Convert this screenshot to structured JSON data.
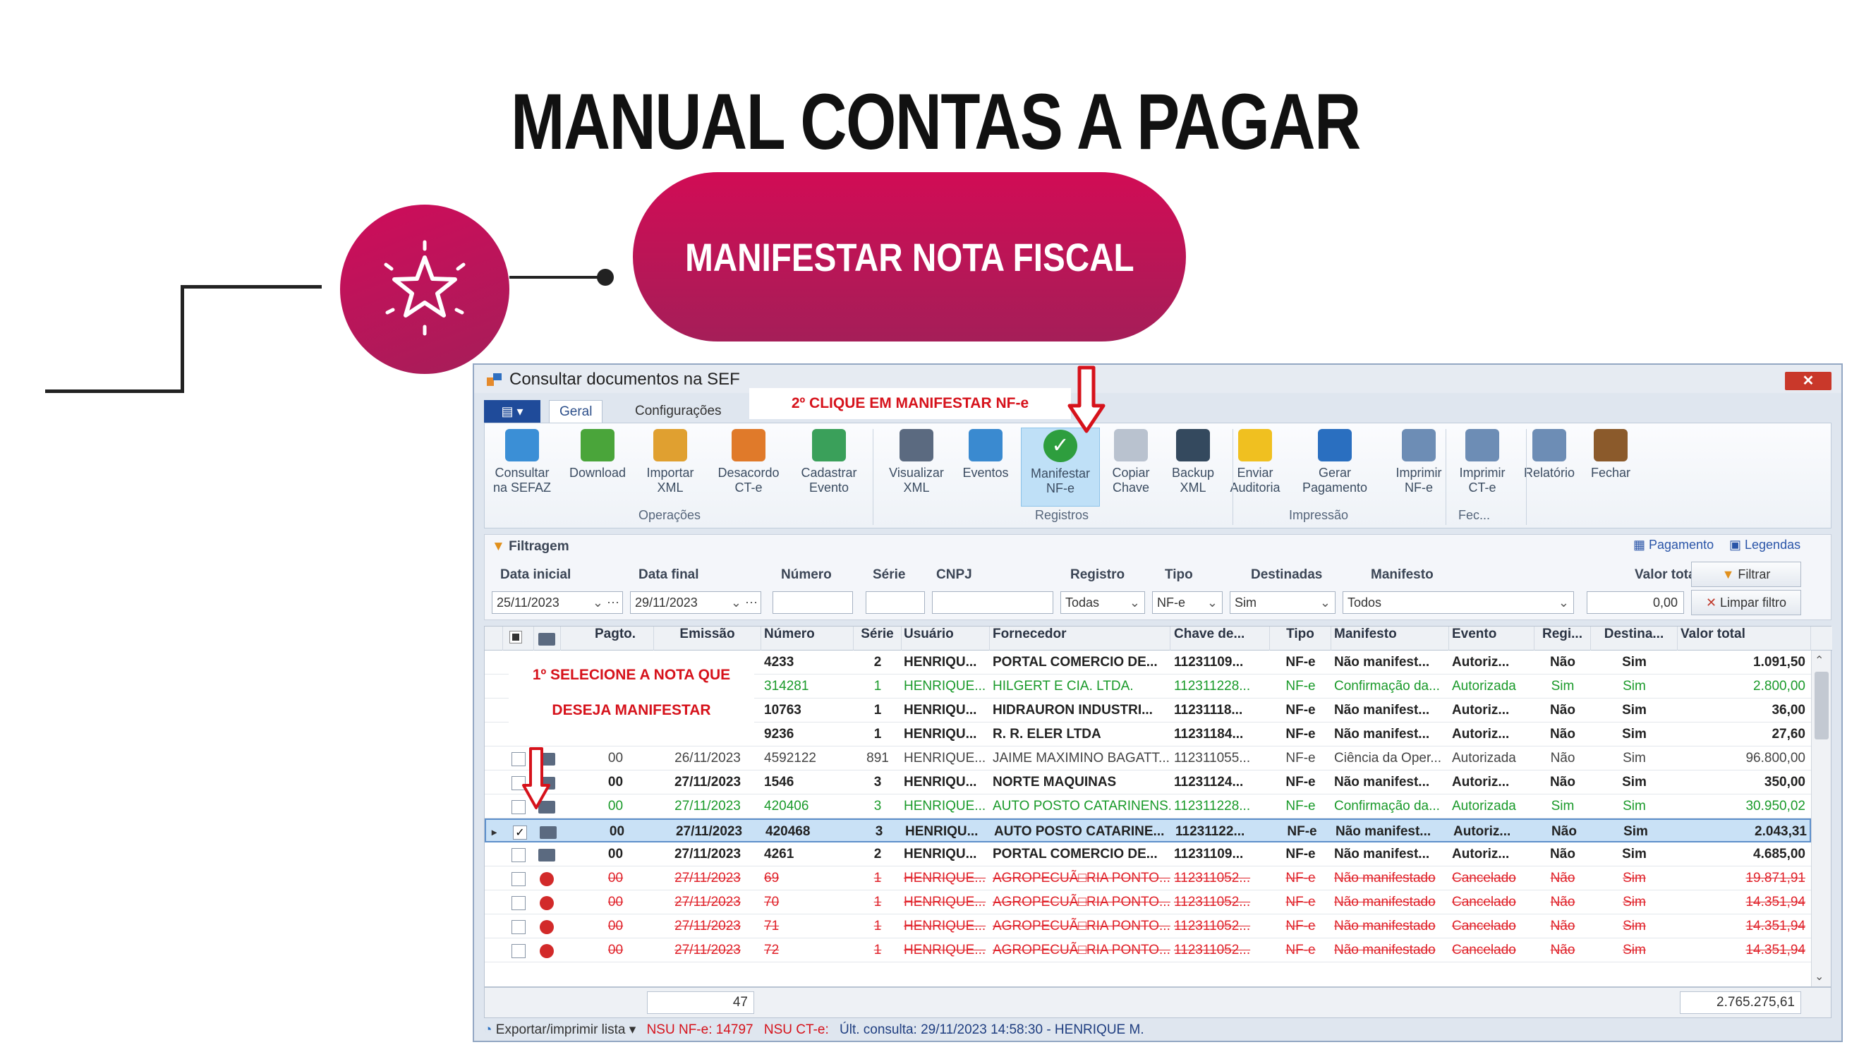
{
  "heading": "MANUAL CONTAS A PAGAR",
  "pill_label": "MANIFESTAR NOTA FISCAL",
  "window": {
    "title": "Consultar documentos na SEF",
    "tabs": [
      "Geral",
      "Configurações"
    ],
    "callout_step2": "2º CLIQUE EM MANIFESTAR NF-e",
    "ribbon_buttons": [
      {
        "label1": "Consultar",
        "label2": "na SEFAZ",
        "icon": "refresh-icon"
      },
      {
        "label1": "Download",
        "label2": "",
        "icon": "download-icon"
      },
      {
        "label1": "Importar",
        "label2": "XML",
        "icon": "import-xml-icon"
      },
      {
        "label1": "Desacordo",
        "label2": "CT-e",
        "icon": "thumbs-down-icon"
      },
      {
        "label1": "Cadastrar",
        "label2": "Evento",
        "icon": "flag-icon"
      },
      {
        "label1": "Visualizar",
        "label2": "XML",
        "icon": "view-xml-icon"
      },
      {
        "label1": "Eventos",
        "label2": "",
        "icon": "magnifier-icon"
      },
      {
        "label1": "Manifestar",
        "label2": "NF-e",
        "icon": "check-circle-icon"
      },
      {
        "label1": "Copiar",
        "label2": "Chave",
        "icon": "copy-icon"
      },
      {
        "label1": "Backup",
        "label2": "XML",
        "icon": "floppy-icon"
      },
      {
        "label1": "Enviar",
        "label2": "Auditoria",
        "icon": "audit-icon"
      },
      {
        "label1": "Gerar",
        "label2": "Pagamento",
        "icon": "payment-icon"
      },
      {
        "label1": "Imprimir",
        "label2": "NF-e",
        "icon": "printer-icon"
      },
      {
        "label1": "Imprimir",
        "label2": "CT-e",
        "icon": "printer-icon"
      },
      {
        "label1": "Relatório",
        "label2": "",
        "icon": "printer-icon"
      },
      {
        "label1": "Fechar",
        "label2": "",
        "icon": "exit-door-icon"
      }
    ],
    "ribbon_groups": [
      "Operações",
      "Registros",
      "Impressão",
      "Fec..."
    ],
    "filter": {
      "title": "Filtragem",
      "pagamento": "Pagamento",
      "legendas": "Legendas",
      "labels": [
        "Data inicial",
        "Data final",
        "Número",
        "Série",
        "CNPJ",
        "Registro",
        "Tipo",
        "Destinadas",
        "Manifesto",
        "Valor total"
      ],
      "data_inicial": "25/11/2023",
      "data_final": "29/11/2023",
      "registro": "Todas",
      "tipo": "NF-e",
      "destinadas": "Sim",
      "manifesto": "Todos",
      "valor_total": "0,00",
      "filtrar": "Filtrar",
      "limpar": "Limpar filtro"
    },
    "grid": {
      "headers": [
        "Pagto.",
        "Emissão",
        "Número",
        "Série",
        "Usuário",
        "Fornecedor",
        "Chave de...",
        "Tipo",
        "Manifesto",
        "Evento",
        "Regi...",
        "Destina...",
        "Valor total"
      ],
      "callout_step1_line1": "1º SELECIONE A NOTA QUE",
      "callout_step1_line2": "DESEJA MANIFESTAR",
      "rows": [
        {
          "style": "bold",
          "check": false,
          "icon": "none",
          "pagto": "",
          "emissao": "",
          "numero": "4233",
          "serie": "2",
          "usuario": "HENRIQU...",
          "fornecedor": "PORTAL COMERCIO DE...",
          "chave": "11231109...",
          "tipo": "NF-e",
          "manifesto": "Não manifest...",
          "evento": "Autoriz...",
          "registro": "Não",
          "destinada": "Sim",
          "valor": "1.091,50"
        },
        {
          "style": "green",
          "check": false,
          "icon": "none",
          "pagto": "",
          "emissao": "",
          "numero": "314281",
          "serie": "1",
          "usuario": "HENRIQUE...",
          "fornecedor": "HILGERT E CIA. LTDA.",
          "chave": "112311228...",
          "tipo": "NF-e",
          "manifesto": "Confirmação da...",
          "evento": "Autorizada",
          "registro": "Sim",
          "destinada": "Sim",
          "valor": "2.800,00"
        },
        {
          "style": "bold",
          "check": false,
          "icon": "none",
          "pagto": "",
          "emissao": "",
          "numero": "10763",
          "serie": "1",
          "usuario": "HENRIQU...",
          "fornecedor": "HIDRAURON INDUSTRI...",
          "chave": "11231118...",
          "tipo": "NF-e",
          "manifesto": "Não manifest...",
          "evento": "Autoriz...",
          "registro": "Não",
          "destinada": "Sim",
          "valor": "36,00"
        },
        {
          "style": "bold",
          "check": false,
          "icon": "none",
          "pagto": "",
          "emissao": "",
          "numero": "9236",
          "serie": "1",
          "usuario": "HENRIQU...",
          "fornecedor": "R. R. ELER LTDA",
          "chave": "11231184...",
          "tipo": "NF-e",
          "manifesto": "Não manifest...",
          "evento": "Autoriz...",
          "registro": "Não",
          "destinada": "Sim",
          "valor": "27,60"
        },
        {
          "style": "norm",
          "check": false,
          "icon": "xml",
          "pagto": "00",
          "emissao": "26/11/2023",
          "numero": "4592122",
          "serie": "891",
          "usuario": "HENRIQUE...",
          "fornecedor": "JAIME MAXIMINO BAGATT...",
          "chave": "112311055...",
          "tipo": "NF-e",
          "manifesto": "Ciência da Oper...",
          "evento": "Autorizada",
          "registro": "Não",
          "destinada": "Sim",
          "valor": "96.800,00"
        },
        {
          "style": "bold",
          "check": false,
          "icon": "xml",
          "pagto": "00",
          "emissao": "27/11/2023",
          "numero": "1546",
          "serie": "3",
          "usuario": "HENRIQU...",
          "fornecedor": "NORTE MAQUINAS",
          "chave": "11231124...",
          "tipo": "NF-e",
          "manifesto": "Não manifest...",
          "evento": "Autoriz...",
          "registro": "Não",
          "destinada": "Sim",
          "valor": "350,00"
        },
        {
          "style": "green",
          "check": false,
          "icon": "xml",
          "pagto": "00",
          "emissao": "27/11/2023",
          "numero": "420406",
          "serie": "3",
          "usuario": "HENRIQUE...",
          "fornecedor": "AUTO POSTO CATARINENS...",
          "chave": "112311228...",
          "tipo": "NF-e",
          "manifesto": "Confirmação da...",
          "evento": "Autorizada",
          "registro": "Sim",
          "destinada": "Sim",
          "valor": "30.950,02"
        },
        {
          "style": "bold sel",
          "check": true,
          "icon": "xml",
          "pagto": "00",
          "emissao": "27/11/2023",
          "numero": "420468",
          "serie": "3",
          "usuario": "HENRIQU...",
          "fornecedor": "AUTO POSTO CATARINE...",
          "chave": "11231122...",
          "tipo": "NF-e",
          "manifesto": "Não manifest...",
          "evento": "Autoriz...",
          "registro": "Não",
          "destinada": "Sim",
          "valor": "2.043,31"
        },
        {
          "style": "bold",
          "check": false,
          "icon": "xml",
          "pagto": "00",
          "emissao": "27/11/2023",
          "numero": "4261",
          "serie": "2",
          "usuario": "HENRIQU...",
          "fornecedor": "PORTAL COMERCIO DE...",
          "chave": "11231109...",
          "tipo": "NF-e",
          "manifesto": "Não manifest...",
          "evento": "Autoriz...",
          "registro": "Não",
          "destinada": "Sim",
          "valor": "4.685,00"
        },
        {
          "style": "red",
          "check": false,
          "icon": "error",
          "pagto": "00",
          "emissao": "27/11/2023",
          "numero": "69",
          "serie": "1",
          "usuario": "HENRIQUE...",
          "fornecedor": "AGROPECUÃ□RIA PONTO...",
          "chave": "112311052...",
          "tipo": "NF-e",
          "manifesto": "Não manifestado",
          "evento": "Cancelado",
          "registro": "Não",
          "destinada": "Sim",
          "valor": "19.871,91"
        },
        {
          "style": "red",
          "check": false,
          "icon": "error",
          "pagto": "00",
          "emissao": "27/11/2023",
          "numero": "70",
          "serie": "1",
          "usuario": "HENRIQUE...",
          "fornecedor": "AGROPECUÃ□RIA PONTO...",
          "chave": "112311052...",
          "tipo": "NF-e",
          "manifesto": "Não manifestado",
          "evento": "Cancelado",
          "registro": "Não",
          "destinada": "Sim",
          "valor": "14.351,94"
        },
        {
          "style": "red",
          "check": false,
          "icon": "error",
          "pagto": "00",
          "emissao": "27/11/2023",
          "numero": "71",
          "serie": "1",
          "usuario": "HENRIQUE...",
          "fornecedor": "AGROPECUÃ□RIA PONTO...",
          "chave": "112311052...",
          "tipo": "NF-e",
          "manifesto": "Não manifestado",
          "evento": "Cancelado",
          "registro": "Não",
          "destinada": "Sim",
          "valor": "14.351,94"
        },
        {
          "style": "red",
          "check": false,
          "icon": "error",
          "pagto": "00",
          "emissao": "27/11/2023",
          "numero": "72",
          "serie": "1",
          "usuario": "HENRIQUE...",
          "fornecedor": "AGROPECUÃ□RIA PONTO...",
          "chave": "112311052...",
          "tipo": "NF-e",
          "manifesto": "Não manifestado",
          "evento": "Cancelado",
          "registro": "Não",
          "destinada": "Sim",
          "valor": "14.351,94"
        }
      ],
      "footer_count": "47",
      "footer_total": "2.765.275,61"
    },
    "status": {
      "export": "Exportar/imprimir lista",
      "nsu_nfe": "NSU NF-e: 14797",
      "nsu_cte": "NSU CT-e:",
      "ultima": "Últ. consulta: 29/11/2023 14:58:30 - HENRIQUE M."
    }
  }
}
